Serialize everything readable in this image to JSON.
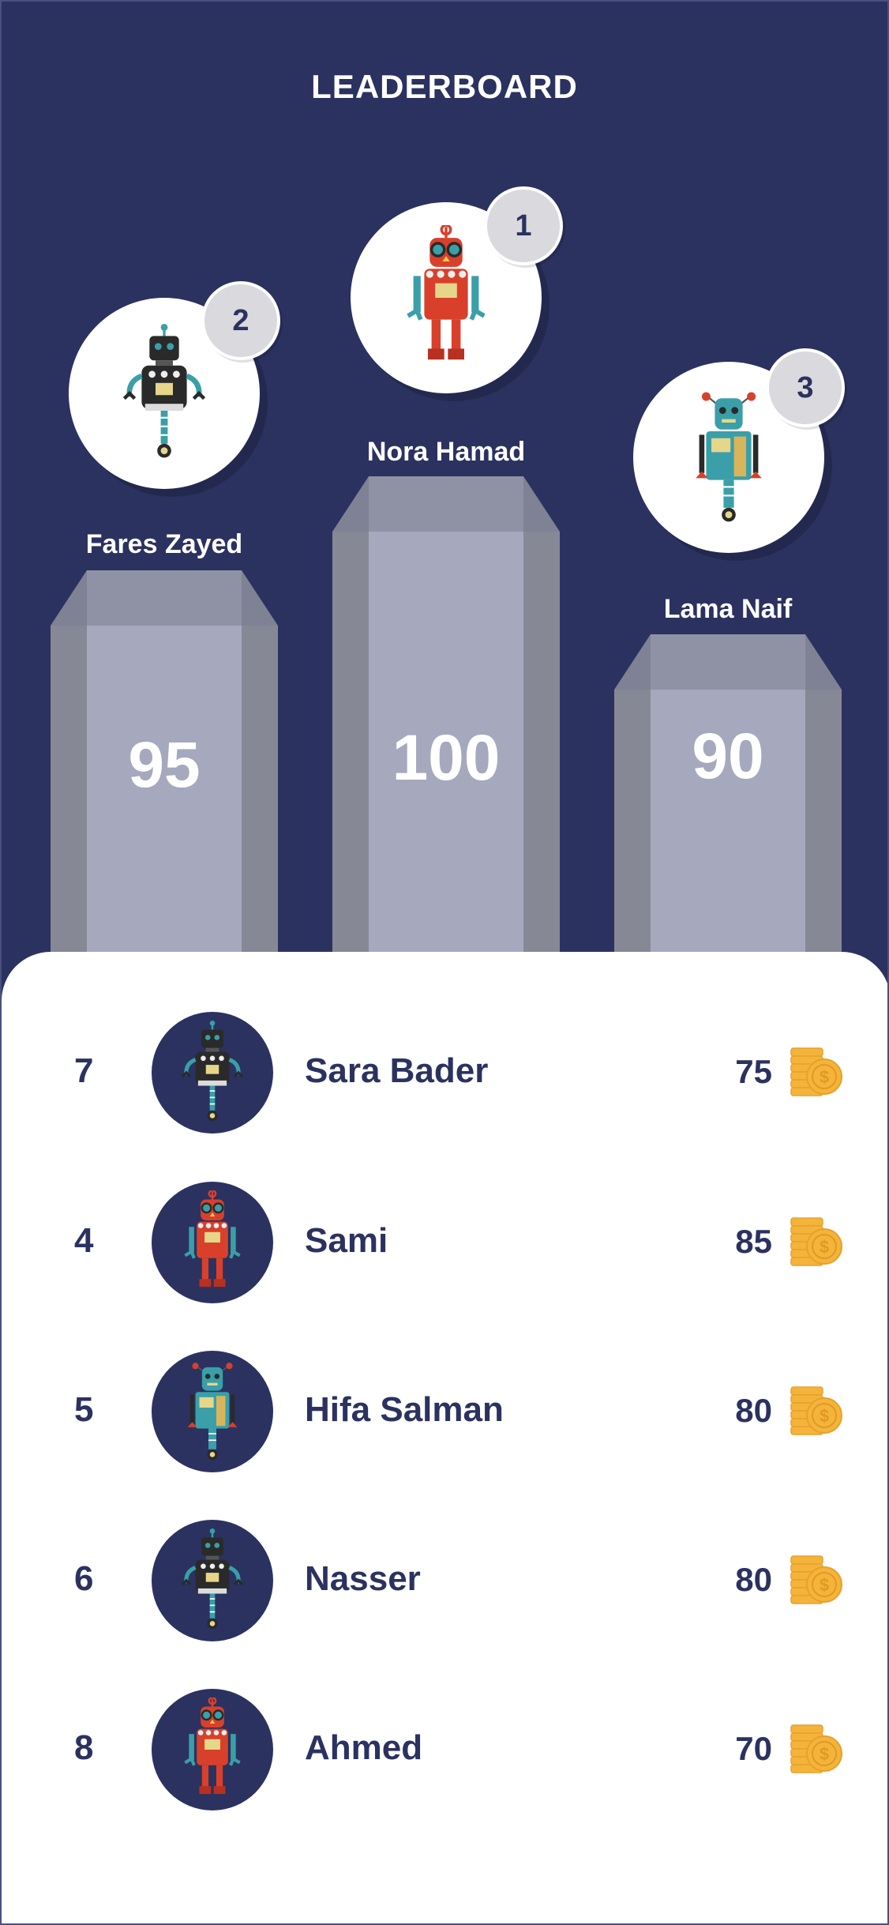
{
  "header": {
    "title": "LEADERBOARD"
  },
  "podium": [
    {
      "place": "2",
      "name": "Fares Zayed",
      "score": "95",
      "robot": "black-robot-icon"
    },
    {
      "place": "1",
      "name": "Nora Hamad",
      "score": "100",
      "robot": "red-robot-icon"
    },
    {
      "place": "3",
      "name": "Lama Naif",
      "score": "90",
      "robot": "teal-robot-icon"
    }
  ],
  "list": [
    {
      "rank": "7",
      "name": "Sara Bader",
      "points": "75",
      "robot": "black-robot-icon"
    },
    {
      "rank": "4",
      "name": "Sami",
      "points": "85",
      "robot": "red-robot-icon"
    },
    {
      "rank": "5",
      "name": "Hifa Salman",
      "points": "80",
      "robot": "teal-robot-icon"
    },
    {
      "rank": "6",
      "name": "Nasser",
      "points": "80",
      "robot": "black-robot-icon"
    },
    {
      "rank": "8",
      "name": "Ahmed",
      "points": "70",
      "robot": "red-robot-icon"
    }
  ],
  "colors": {
    "background": "#2b3260",
    "pillar_front": "#a6a9bd",
    "pillar_side": "#878895",
    "coin": "#f4b43c",
    "badge": "#d9d9de"
  },
  "icons": {
    "coin": "coin-stack-icon"
  }
}
